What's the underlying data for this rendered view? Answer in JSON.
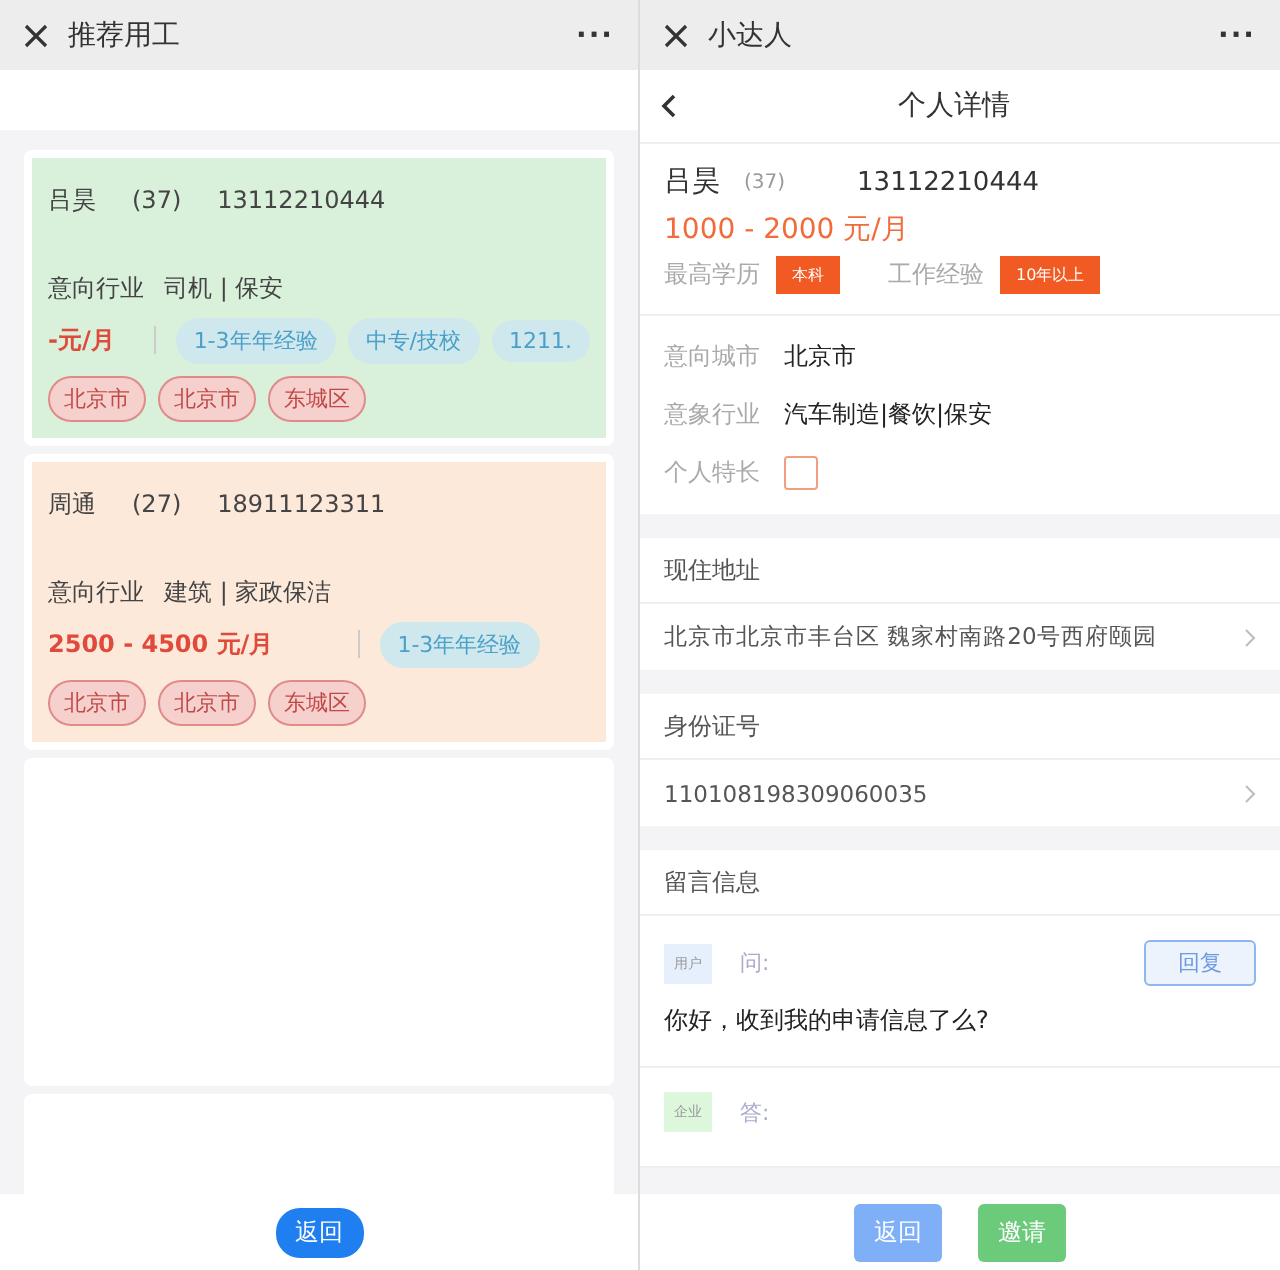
{
  "left": {
    "title": "推荐用工",
    "menu": "···",
    "cards": [
      {
        "color": "#d9f0da",
        "name": "吕昊",
        "age": "(37)",
        "phone": "13112210444",
        "industry_label": "意向行业",
        "industry": "司机 | 保安",
        "salary": "-元/月",
        "chips": [
          "1-3年年经验",
          "中专/技校",
          "1211."
        ],
        "locations": [
          "北京市",
          "北京市",
          "东城区"
        ]
      },
      {
        "color": "#fde9da",
        "name": "周通",
        "age": "(27)",
        "phone": "18911123311",
        "industry_label": "意向行业",
        "industry": "建筑 | 家政保洁",
        "salary": "2500 - 4500 元/月",
        "chips": [
          "1-3年年经验"
        ],
        "locations": [
          "北京市",
          "北京市",
          "东城区"
        ]
      }
    ],
    "back_button": "返回"
  },
  "right": {
    "title": "小达人",
    "menu": "···",
    "page_title": "个人详情",
    "profile": {
      "name": "吕昊",
      "age": "(37)",
      "phone": "13112210444",
      "salary": "1000 - 2000 元/月",
      "education_label": "最高学历",
      "education": "本科",
      "experience_label": "工作经验",
      "experience": "10年以上"
    },
    "fields": [
      {
        "kind": "text",
        "label": "意向城市",
        "value": "北京市"
      },
      {
        "kind": "text",
        "label": "意象行业",
        "value": "汽车制造|餐饮|保安"
      },
      {
        "kind": "checkbox",
        "label": "个人特长",
        "checked": false
      }
    ],
    "sections": [
      {
        "heading": "现住地址",
        "value": "北京市北京市丰台区 魏家村南路20号西府颐园"
      },
      {
        "heading": "身份证号",
        "value": "110108198309060035"
      }
    ],
    "messages": {
      "heading": "留言信息",
      "items": [
        {
          "badge": "用户",
          "color": "#e6f0fd",
          "label": "问:",
          "text": "你好，收到我的申请信息了么?",
          "reply_button": "回复"
        },
        {
          "badge": "企业",
          "color": "#ddf7dd",
          "label": "答:"
        }
      ]
    },
    "buttons": [
      {
        "kind": "back",
        "label": "返回"
      },
      {
        "kind": "invite",
        "label": "邀请"
      }
    ]
  }
}
